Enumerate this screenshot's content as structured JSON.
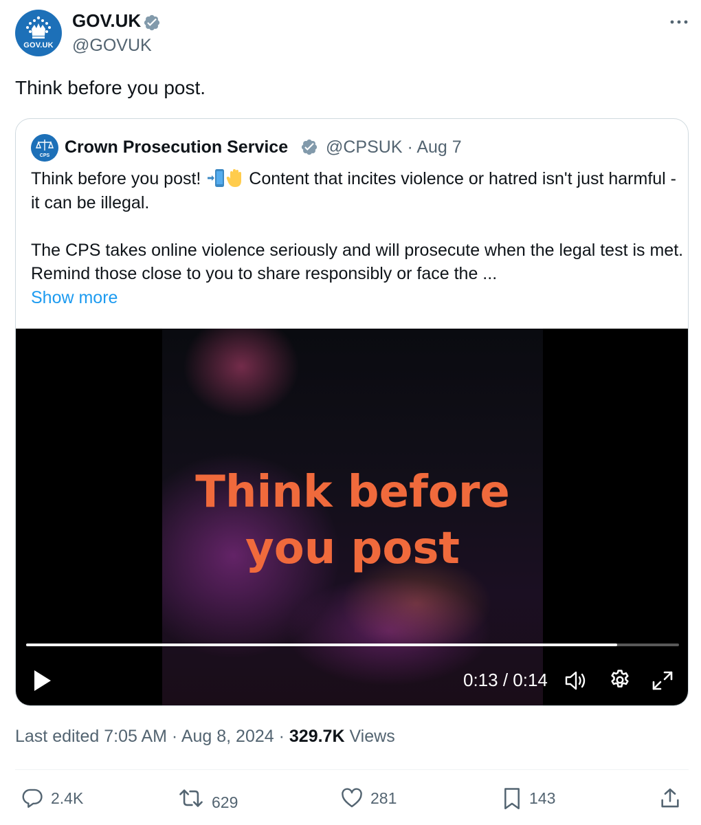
{
  "author": {
    "display_name": "GOV.UK",
    "handle": "@GOVUK",
    "avatar_label": "GOV.UK"
  },
  "tweet_text": "Think before you post.",
  "quoted": {
    "display_name": "Crown Prosecution Service",
    "handle_date": "@CPSUK · Aug 7",
    "avatar_label": "CPS",
    "para1_a": "Think before you post! ",
    "para1_b": " Content that incites violence or hatred isn't just harmful - it can be illegal.",
    "para2": "The CPS takes online violence seriously and will prosecute when the legal test is met. Remind those close to you to share responsibly or face the ...",
    "show_more": "Show more",
    "emojis": [
      "mobile-arrow-emoji",
      "raised-hand-emoji"
    ]
  },
  "video": {
    "title_line1": "Think before",
    "title_line2": "you post",
    "time_display": "0:13 / 0:14",
    "progress": 0.905
  },
  "meta": {
    "edited": "Last edited 7:05 AM · Aug 8, 2024 · ",
    "views_count": "329.7K",
    "views_label": " Views"
  },
  "actions": {
    "replies": "2.4K",
    "reposts": "629",
    "likes": "281",
    "bookmarks": "143"
  },
  "colors": {
    "brand_blue": "#1d70b8",
    "link_blue": "#1d9bf0",
    "verified_gray": "#829aab",
    "secondary_text": "#536471",
    "video_title_orange": "#f06a3c"
  },
  "icons": [
    "verified-badge-icon",
    "more-icon",
    "play-icon",
    "volume-icon",
    "gear-icon",
    "fullscreen-icon",
    "reply-icon",
    "repost-icon",
    "like-icon",
    "bookmark-icon",
    "share-icon"
  ]
}
